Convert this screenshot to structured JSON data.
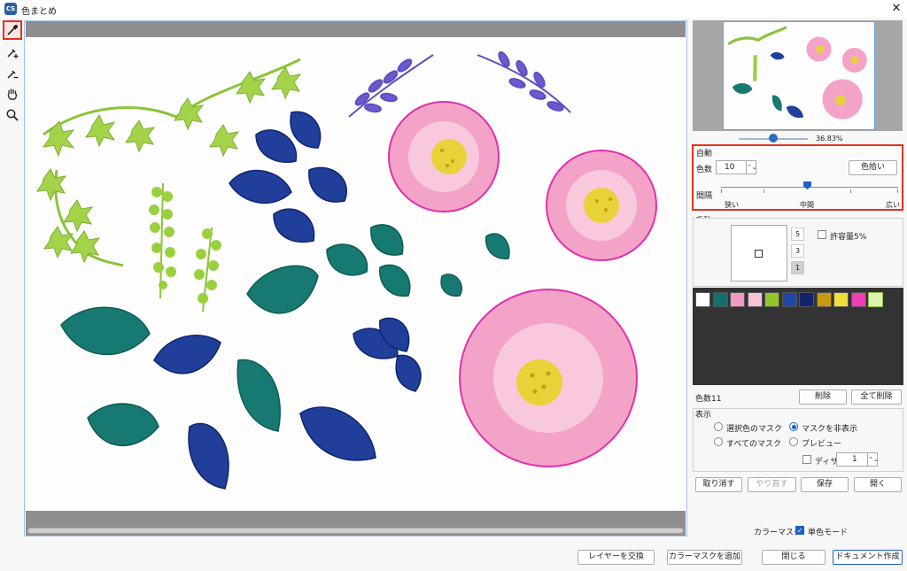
{
  "window": {
    "title": "色まとめ",
    "logo": "CS"
  },
  "tools": [
    {
      "name": "eyedropper-icon",
      "selected": true
    },
    {
      "name": "eyedropper-plus-icon",
      "selected": false
    },
    {
      "name": "eyedropper-minus-icon",
      "selected": false
    },
    {
      "name": "hand-icon",
      "selected": false
    },
    {
      "name": "magnifier-icon",
      "selected": false
    }
  ],
  "preview": {
    "zoom": "36.83%",
    "zoom_fraction": 0.45
  },
  "auto": {
    "title": "自動",
    "count_label": "色数",
    "count_value": "10",
    "pick_button": "色拾い",
    "interval_label": "間隔",
    "interval_left": "狭い",
    "interval_mid": "中間",
    "interval_right": "広い",
    "interval_fraction": 0.5
  },
  "manual": {
    "title": "手動",
    "sizes": [
      "5",
      "3",
      "1"
    ],
    "selected_size": "1",
    "tolerance_label": "許容量5%"
  },
  "palette": {
    "colors": [
      "#ffffff",
      "#156f6e",
      "#f09ac3",
      "#f6c3d8",
      "#93c62d",
      "#1f48a5",
      "#13236e",
      "#c89a10",
      "#f0de3b",
      "#ee3fb6",
      "#def2b3"
    ]
  },
  "palette_actions": {
    "count_text": "色数11",
    "delete": "削除",
    "delete_all": "全て削除"
  },
  "display": {
    "title": "表示",
    "options": [
      {
        "label": "選択色のマスク",
        "selected": false
      },
      {
        "label": "マスクを非表示",
        "selected": true
      },
      {
        "label": "すべてのマスク",
        "selected": false
      },
      {
        "label": "プレビュー",
        "selected": false
      }
    ],
    "dither_label": "ディザ",
    "dither_checked": false,
    "dither_value": "1"
  },
  "actions": {
    "undo": "取り消す",
    "redo": "やり直す",
    "save": "保存",
    "open": "開く"
  },
  "color_mask": {
    "label": "カラーマスク",
    "mono_label": "単色モード",
    "mono_checked": true
  },
  "footer": {
    "swap": "レイヤーを交換",
    "add_mask": "カラーマスクを追加",
    "close": "閉じる",
    "create": "ドキュメント作成"
  }
}
